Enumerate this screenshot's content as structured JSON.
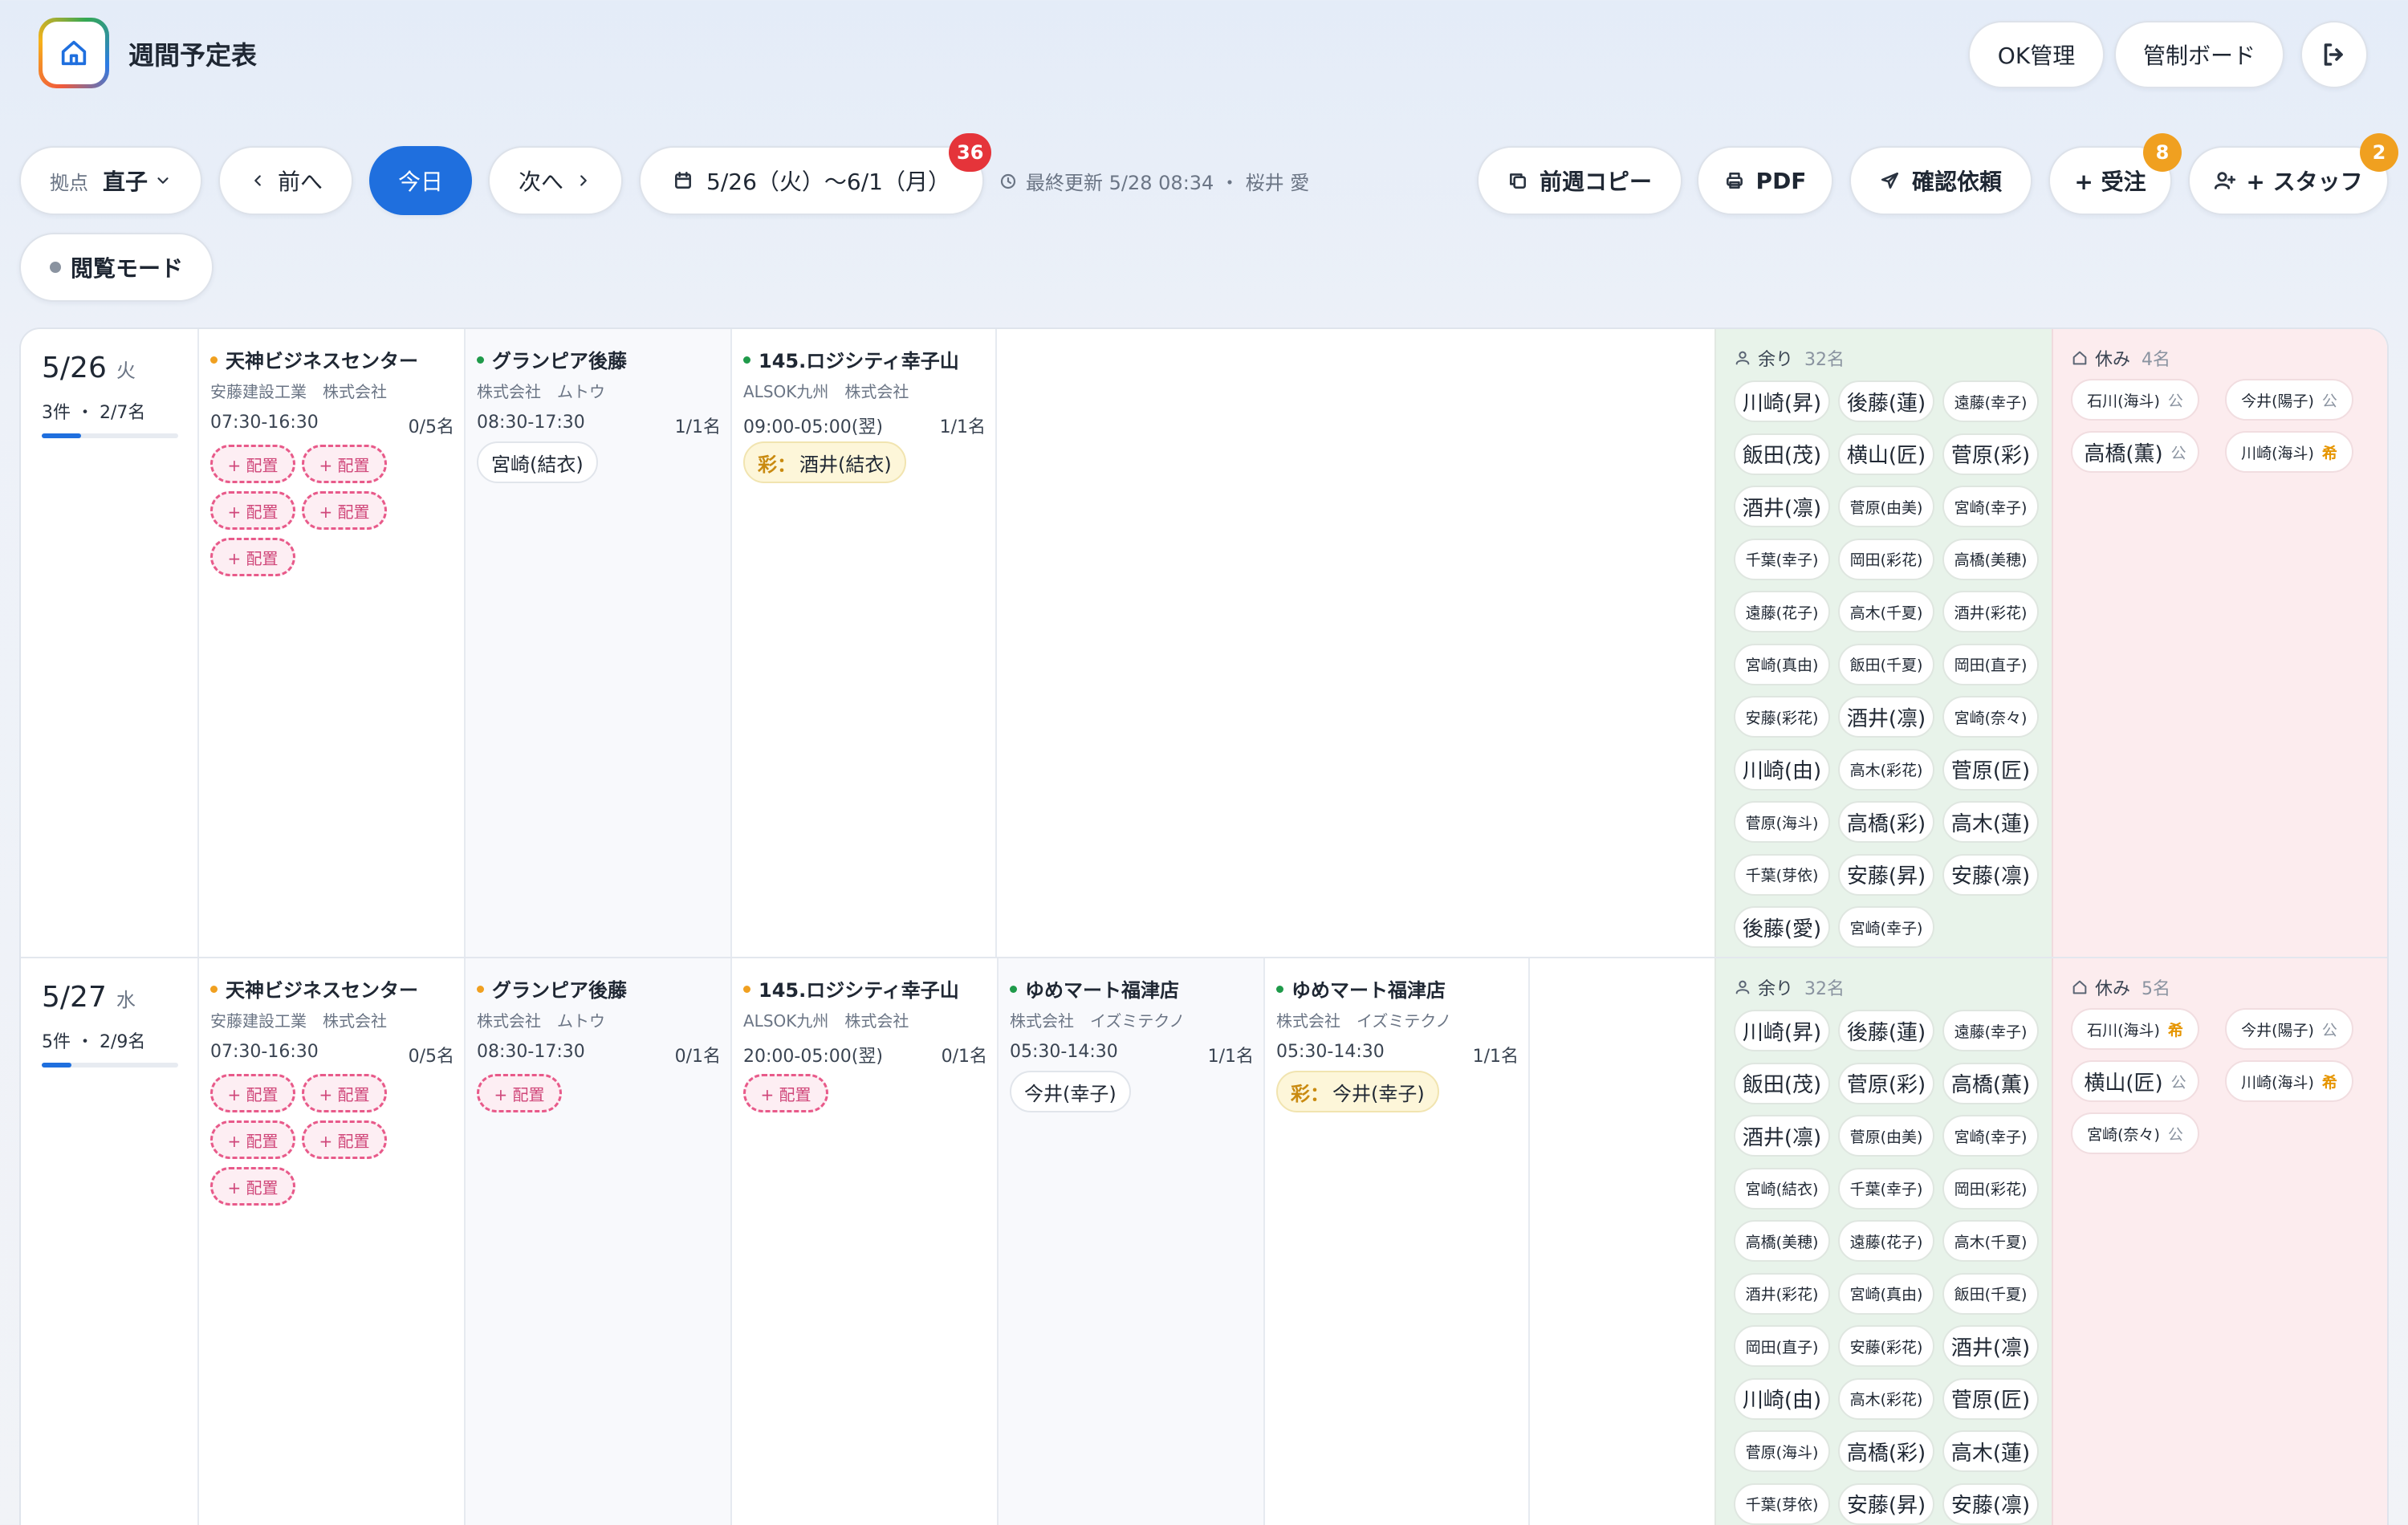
{
  "app": {
    "title": "週間予定表"
  },
  "header": {
    "ok_label": "OK管理",
    "board_label": "管制ボード"
  },
  "toolbar": {
    "base_label": "拠点",
    "base_value": "直子",
    "prev_label": "前へ",
    "today_label": "今日",
    "next_label": "次へ",
    "range_label": "5/26（火）～6/1（月）",
    "range_badge": "36",
    "updated_label": "最終更新 5/28 08:34 ・ 桜井 愛",
    "copy_label": "前週コピー",
    "pdf_label": "PDF",
    "confirm_label": "確認依頼",
    "order_label": "+ 受注",
    "order_badge": "8",
    "staff_label": "+ スタッフ",
    "staff_badge": "2",
    "view_mode_label": "閲覧モード"
  },
  "labels": {
    "slot_label": "+ 配置",
    "spare_label": "余り",
    "off_label": "休み",
    "public_tag": "公",
    "request_tag": "希",
    "lead_prefix": "彩："
  },
  "days": [
    {
      "date": "5/26",
      "weekday": "火",
      "summary": "3件 ・ 2/7名",
      "progress": 0.29,
      "sites": [
        {
          "dot_color": "#f0a020",
          "name": "天神ビジネスセンター",
          "client": "安藤建設工業　株式会社",
          "time": "07:30-16:30",
          "count": "0/5名",
          "assigned": [],
          "open_slots": 5
        },
        {
          "dot_color": "#1f9a4a",
          "name": "グランピア後藤",
          "client": "株式会社　ムトウ",
          "time": "08:30-17:30",
          "count": "1/1名",
          "assigned": [
            {
              "name": "宮崎(結衣)",
              "lead": false
            }
          ],
          "open_slots": 0
        },
        {
          "dot_color": "#1f9a4a",
          "name": "145.ロジシティ幸子山",
          "client": "ALSOK九州　株式会社",
          "time": "09:00-05:00(翌)",
          "count": "1/1名",
          "assigned": [
            {
              "name": "酒井(結衣)",
              "lead": true
            }
          ],
          "open_slots": 0
        }
      ],
      "spare_count": "32名",
      "spare": [
        [
          "川崎(昇)",
          "後藤(蓮)",
          "遠藤(幸子)"
        ],
        [
          "飯田(茂)",
          "横山(匠)",
          "菅原(彩)"
        ],
        [
          "酒井(凛)",
          "菅原(由美)",
          "宮崎(幸子)"
        ],
        [
          "千葉(幸子)",
          "岡田(彩花)",
          "高橋(美穂)"
        ],
        [
          "遠藤(花子)",
          "高木(千夏)",
          "酒井(彩花)"
        ],
        [
          "宮崎(真由)",
          "飯田(千夏)",
          "岡田(直子)"
        ],
        [
          "安藤(彩花)",
          "酒井(凛)",
          "宮崎(奈々)"
        ],
        [
          "川崎(由)",
          "高木(彩花)",
          "菅原(匠)"
        ],
        [
          "菅原(海斗)",
          "高橋(彩)",
          "高木(蓮)"
        ],
        [
          "千葉(芽依)",
          "安藤(昇)",
          "安藤(凛)"
        ],
        [
          "後藤(愛)",
          "宮崎(幸子)"
        ]
      ],
      "off_count": "4名",
      "off": [
        {
          "name": "石川(海斗)",
          "tag": "公"
        },
        {
          "name": "今井(陽子)",
          "tag": "公"
        },
        {
          "name": "高橋(薫)",
          "tag": "公"
        },
        {
          "name": "川崎(海斗)",
          "tag": "希"
        }
      ]
    },
    {
      "date": "5/27",
      "weekday": "水",
      "summary": "5件 ・ 2/9名",
      "progress": 0.22,
      "sites": [
        {
          "dot_color": "#f0a020",
          "name": "天神ビジネスセンター",
          "client": "安藤建設工業　株式会社",
          "time": "07:30-16:30",
          "count": "0/5名",
          "assigned": [],
          "open_slots": 5
        },
        {
          "dot_color": "#f0a020",
          "name": "グランピア後藤",
          "client": "株式会社　ムトウ",
          "time": "08:30-17:30",
          "count": "0/1名",
          "assigned": [],
          "open_slots": 1
        },
        {
          "dot_color": "#f0a020",
          "name": "145.ロジシティ幸子山",
          "client": "ALSOK九州　株式会社",
          "time": "20:00-05:00(翌)",
          "count": "0/1名",
          "assigned": [],
          "open_slots": 1
        },
        {
          "dot_color": "#1f9a4a",
          "name": "ゆめマート福津店",
          "client": "株式会社　イズミテクノ",
          "time": "05:30-14:30",
          "count": "1/1名",
          "assigned": [
            {
              "name": "今井(幸子)",
              "lead": false
            }
          ],
          "open_slots": 0
        },
        {
          "dot_color": "#1f9a4a",
          "name": "ゆめマート福津店",
          "client": "株式会社　イズミテクノ",
          "time": "05:30-14:30",
          "count": "1/1名",
          "assigned": [
            {
              "name": "今井(幸子)",
              "lead": true
            }
          ],
          "open_slots": 0
        }
      ],
      "spare_count": "32名",
      "spare": [
        [
          "川崎(昇)",
          "後藤(蓮)",
          "遠藤(幸子)"
        ],
        [
          "飯田(茂)",
          "菅原(彩)",
          "高橋(薫)"
        ],
        [
          "酒井(凛)",
          "菅原(由美)",
          "宮崎(幸子)"
        ],
        [
          "宮崎(結衣)",
          "千葉(幸子)",
          "岡田(彩花)"
        ],
        [
          "高橋(美穂)",
          "遠藤(花子)",
          "高木(千夏)"
        ],
        [
          "酒井(彩花)",
          "宮崎(真由)",
          "飯田(千夏)"
        ],
        [
          "岡田(直子)",
          "安藤(彩花)",
          "酒井(凛)"
        ],
        [
          "川崎(由)",
          "高木(彩花)",
          "菅原(匠)"
        ],
        [
          "菅原(海斗)",
          "高橋(彩)",
          "高木(蓮)"
        ],
        [
          "千葉(芽依)",
          "安藤(昇)",
          "安藤(凛)"
        ]
      ],
      "off_count": "5名",
      "off": [
        {
          "name": "石川(海斗)",
          "tag": "希"
        },
        {
          "name": "今井(陽子)",
          "tag": "公"
        },
        {
          "name": "横山(匠)",
          "tag": "公"
        },
        {
          "name": "川崎(海斗)",
          "tag": "希"
        },
        {
          "name": "宮崎(奈々)",
          "tag": "公"
        }
      ]
    }
  ]
}
